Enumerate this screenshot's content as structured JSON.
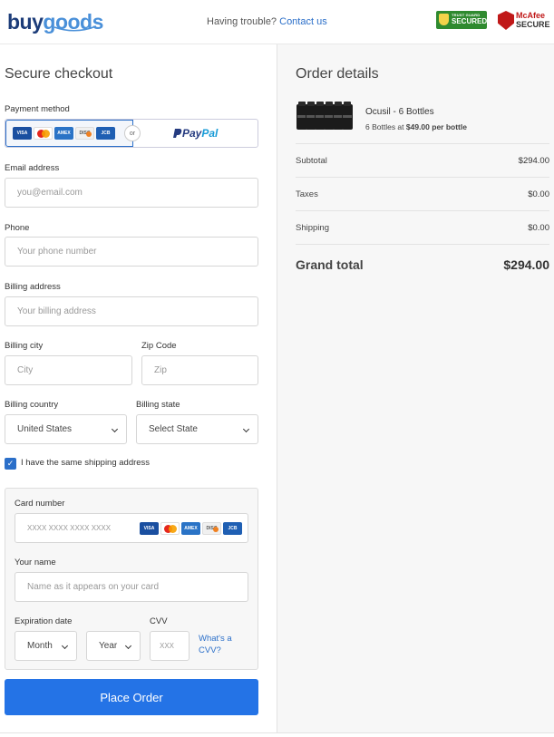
{
  "header": {
    "logo_buy": "buy",
    "logo_goods": "goods",
    "trouble_text": "Having trouble?",
    "contact_link": "Contact us",
    "secured_badge_top": "TRUST GUARD",
    "secured_badge_main": "SECURED",
    "mcafee_top": "McAfee",
    "mcafee_bottom": "SECURE"
  },
  "checkout": {
    "title": "Secure checkout",
    "payment_method_label": "Payment method",
    "or_label": "or",
    "card_icons": [
      "VISA",
      "mastercard",
      "AMEX",
      "DISCOVER",
      "JCB"
    ],
    "paypal_pay": "Pay",
    "paypal_pal": "Pal",
    "email": {
      "label": "Email address",
      "placeholder": "you@email.com"
    },
    "phone": {
      "label": "Phone",
      "placeholder": "Your phone number"
    },
    "billing_address": {
      "label": "Billing address",
      "placeholder": "Your billing address"
    },
    "city": {
      "label": "Billing city",
      "placeholder": "City"
    },
    "zip": {
      "label": "Zip Code",
      "placeholder": "Zip"
    },
    "country": {
      "label": "Billing country",
      "value": "United States"
    },
    "state": {
      "label": "Billing state",
      "value": "Select State"
    },
    "same_shipping": {
      "label": "I have the same shipping address",
      "checked": true
    },
    "card": {
      "number_label": "Card number",
      "number_placeholder": "XXXX XXXX XXXX XXXX",
      "name_label": "Your name",
      "name_placeholder": "Name as it appears on your card",
      "expiration_label": "Expiration date",
      "month_value": "Month",
      "year_value": "Year",
      "cvv_label": "CVV",
      "cvv_placeholder": "XXX",
      "whats_cvv_line1": "What's a",
      "whats_cvv_line2": "CVV?"
    },
    "place_order": "Place Order"
  },
  "order": {
    "title": "Order details",
    "product_name": "Ocusil - 6 Bottles",
    "product_sub_prefix": "6 Bottles at ",
    "product_sub_price": "$49.00 per bottle",
    "bottle_label": "OCUSIL",
    "subtotal_label": "Subtotal",
    "subtotal_value": "$294.00",
    "taxes_label": "Taxes",
    "taxes_value": "$0.00",
    "shipping_label": "Shipping",
    "shipping_value": "$0.00",
    "grand_total_label": "Grand total",
    "grand_total_value": "$294.00"
  },
  "colors": {
    "accent": "#2473e6",
    "link": "#2b6fc9",
    "secured_green": "#2f8a2f",
    "mcafee_red": "#c01818"
  }
}
